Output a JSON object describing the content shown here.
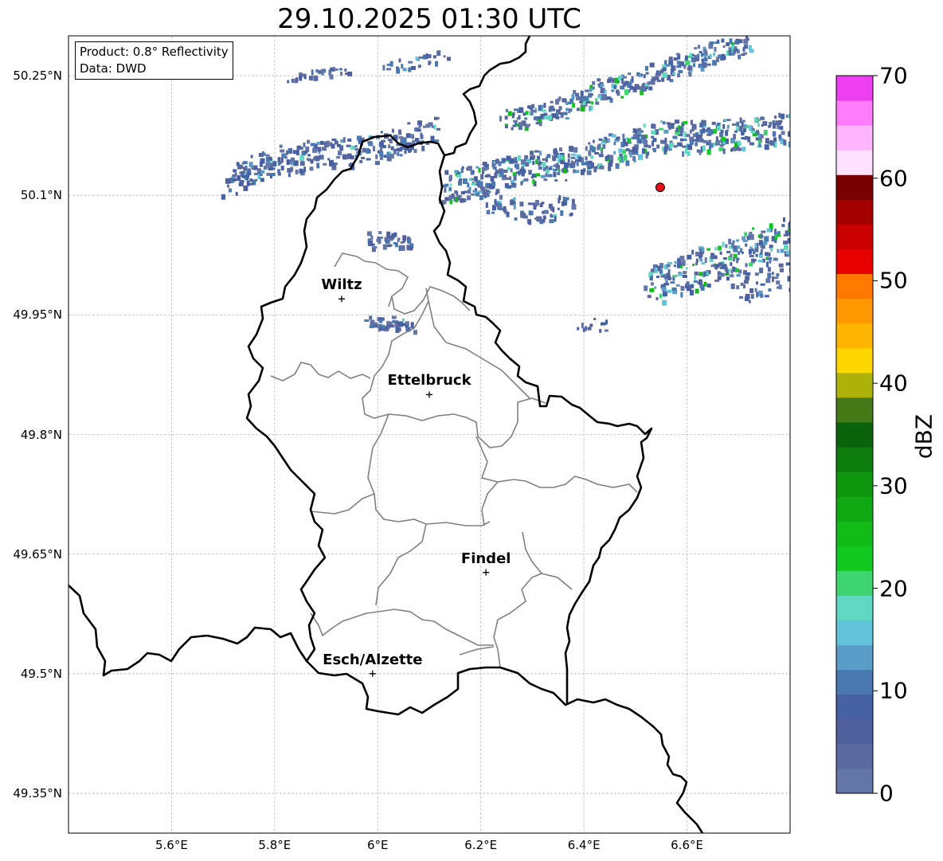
{
  "title": "29.10.2025 01:30 UTC",
  "info": {
    "product": "Product: 0.8° Reflectivity",
    "data": "Data: DWD"
  },
  "map": {
    "lon_range": [
      5.4,
      6.8
    ],
    "lat_range": [
      49.3,
      50.3
    ],
    "lat_ticks": [
      {
        "value": 50.25,
        "label": "50.25°N"
      },
      {
        "value": 50.1,
        "label": "50.1°N"
      },
      {
        "value": 49.95,
        "label": "49.95°N"
      },
      {
        "value": 49.8,
        "label": "49.8°N"
      },
      {
        "value": 49.65,
        "label": "49.65°N"
      },
      {
        "value": 49.5,
        "label": "49.5°N"
      },
      {
        "value": 49.35,
        "label": "49.35°N"
      }
    ],
    "lon_ticks": [
      {
        "value": 5.6,
        "label": "5.6°E"
      },
      {
        "value": 5.8,
        "label": "5.8°E"
      },
      {
        "value": 6.0,
        "label": "6°E"
      },
      {
        "value": 6.2,
        "label": "6.2°E"
      },
      {
        "value": 6.4,
        "label": "6.4°E"
      },
      {
        "value": 6.6,
        "label": "6.6°E"
      }
    ],
    "cities": [
      {
        "name": "Wiltz",
        "lon": 5.93,
        "lat": 49.97
      },
      {
        "name": "Ettelbruck",
        "lon": 6.1,
        "lat": 49.85
      },
      {
        "name": "Findel",
        "lon": 6.21,
        "lat": 49.627
      },
      {
        "name": "Esch/Alzette",
        "lon": 5.99,
        "lat": 49.5
      }
    ],
    "radar_site": {
      "lon": 6.548,
      "lat": 50.11,
      "color": "#e8101a"
    }
  },
  "colorbar": {
    "label": "dBZ",
    "ticks": [
      {
        "value": 70,
        "label": "70"
      },
      {
        "value": 60,
        "label": "60"
      },
      {
        "value": 50,
        "label": "50"
      },
      {
        "value": 40,
        "label": "40"
      },
      {
        "value": 30,
        "label": "30"
      },
      {
        "value": 20,
        "label": "20"
      },
      {
        "value": 10,
        "label": "10"
      },
      {
        "value": 0,
        "label": "0"
      }
    ],
    "range": [
      0,
      70
    ],
    "colors": [
      "#6476a8",
      "#5a6aa0",
      "#50609c",
      "#4660a4",
      "#4a78b0",
      "#5a9cc8",
      "#62c4da",
      "#5ed8c0",
      "#40d470",
      "#10c820",
      "#12ba18",
      "#10a812",
      "#0e960e",
      "#0c7c0c",
      "#0a620a",
      "#457817",
      "#adb20a",
      "#ffd600",
      "#ffb400",
      "#ff9800",
      "#ff7800",
      "#e80000",
      "#c80000",
      "#a40000",
      "#780000",
      "#ffe0fe",
      "#ffb4fe",
      "#ff7cfa",
      "#ee3ef2"
    ]
  }
}
